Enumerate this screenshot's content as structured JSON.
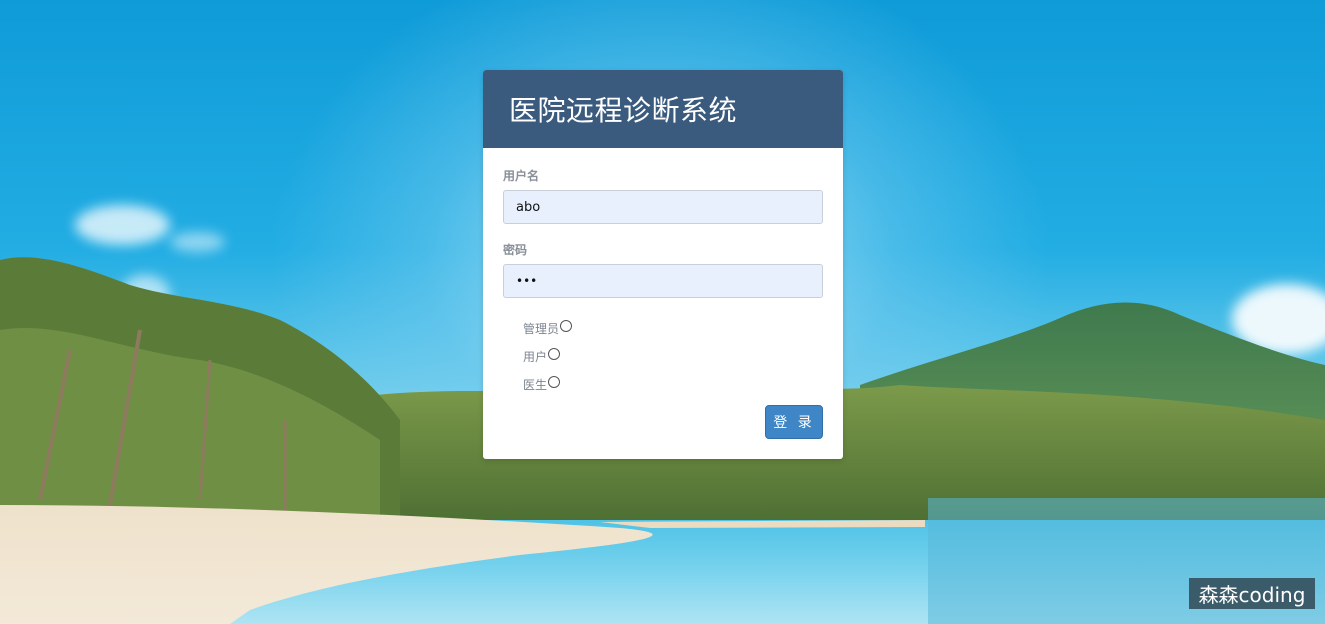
{
  "login": {
    "title": "医院远程诊断系统",
    "username_label": "用户名",
    "username_value": "abo",
    "password_label": "密码",
    "password_value": "•••",
    "roles": [
      "管理员",
      "用户",
      "医生"
    ],
    "submit_label": "登 录"
  },
  "watermark": "森森coding",
  "colors": {
    "header": "#3a5a7e",
    "button": "#3f86c7",
    "input_bg": "#e8f0fe"
  }
}
